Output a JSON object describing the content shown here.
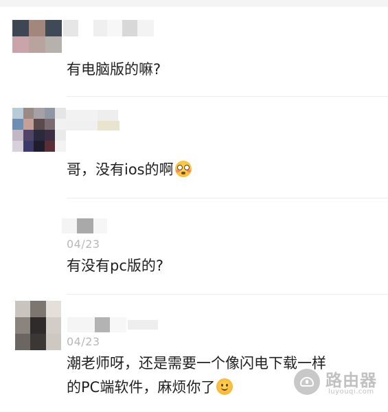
{
  "comments": [
    {
      "text": "有电脑版的嘛?"
    },
    {
      "text": "哥，没有ios的啊",
      "emoji": "flushed-face"
    },
    {
      "date": "04/23",
      "text": "有没有pc版的?"
    },
    {
      "date": "04/23",
      "lines": [
        "潮老师呀，还是需要一个像闪电下载一样",
        "的PC端软件，麻烦你了"
      ],
      "emoji": "smiling-face"
    }
  ],
  "watermark": {
    "title": "路由器",
    "url": "luyouqi.com"
  },
  "colors": {
    "text": "#1f1f1f",
    "date": "#b7b7b7",
    "divider": "#ececec"
  }
}
